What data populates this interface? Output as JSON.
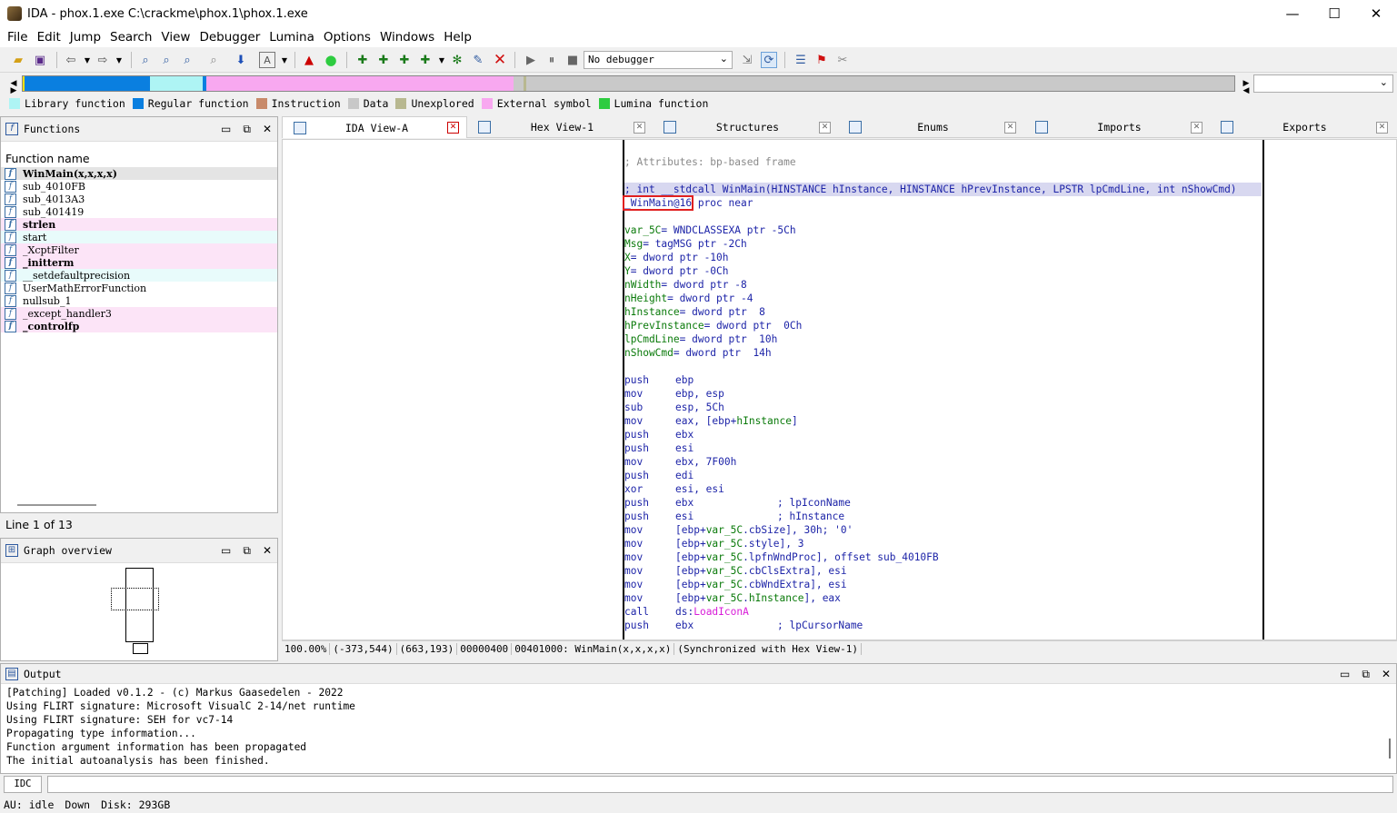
{
  "window": {
    "title": "IDA - phox.1.exe C:\\crackme\\phox.1\\phox.1.exe",
    "minimize": "—",
    "maximize": "☐",
    "close": "✕"
  },
  "menu": [
    "File",
    "Edit",
    "Jump",
    "Search",
    "View",
    "Debugger",
    "Lumina",
    "Options",
    "Windows",
    "Help"
  ],
  "toolbar": {
    "debugger_select": "No debugger"
  },
  "legend": [
    {
      "label": "Library function",
      "color": "#aef4f4"
    },
    {
      "label": "Regular function",
      "color": "#0a7fe0"
    },
    {
      "label": "Instruction",
      "color": "#c88a6a"
    },
    {
      "label": "Data",
      "color": "#c8c8c8"
    },
    {
      "label": "Unexplored",
      "color": "#b8b890"
    },
    {
      "label": "External symbol",
      "color": "#f8a8f0"
    },
    {
      "label": "Lumina function",
      "color": "#2ecc40"
    }
  ],
  "tabs": [
    {
      "label": "IDA View-A"
    },
    {
      "label": "Hex View-1"
    },
    {
      "label": "Structures"
    },
    {
      "label": "Enums"
    },
    {
      "label": "Imports"
    },
    {
      "label": "Exports"
    }
  ],
  "functions": {
    "title": "Functions",
    "column_header": "Function name",
    "items": [
      {
        "name": "WinMain(x,x,x,x)",
        "style": "sel bold"
      },
      {
        "name": "sub_4010FB",
        "style": ""
      },
      {
        "name": "sub_4013A3",
        "style": ""
      },
      {
        "name": "sub_401419",
        "style": ""
      },
      {
        "name": "strlen",
        "style": "ext bold"
      },
      {
        "name": "start",
        "style": "lib"
      },
      {
        "name": "_XcptFilter",
        "style": "ext"
      },
      {
        "name": "_initterm",
        "style": "ext bold"
      },
      {
        "name": "__setdefaultprecision",
        "style": "lib"
      },
      {
        "name": "UserMathErrorFunction",
        "style": ""
      },
      {
        "name": "nullsub_1",
        "style": ""
      },
      {
        "name": "_except_handler3",
        "style": "ext"
      },
      {
        "name": "_controlfp",
        "style": "ext bold"
      }
    ],
    "line_count": "Line 1 of 13"
  },
  "graph": {
    "title": "Graph overview"
  },
  "code": {
    "attributes": "; Attributes: bp-based frame",
    "signature": "; int __stdcall WinMain(HINSTANCE hInstance, HINSTANCE hPrevInstance, LPSTR lpCmdLine, int nShowCmd)",
    "proc_name": "_WinMain@16",
    "proc_rest": " proc near",
    "vars": [
      [
        "var_5C",
        "= WNDCLASSEXA ptr -5Ch"
      ],
      [
        "Msg",
        "= tagMSG ptr -2Ch"
      ],
      [
        "X",
        "= dword ptr -10h"
      ],
      [
        "Y",
        "= dword ptr -0Ch"
      ],
      [
        "nWidth",
        "= dword ptr -8"
      ],
      [
        "nHeight",
        "= dword ptr -4"
      ],
      [
        "hInstance",
        "= dword ptr  8"
      ],
      [
        "hPrevInstance",
        "= dword ptr  0Ch"
      ],
      [
        "lpCmdLine",
        "= dword ptr  10h"
      ],
      [
        "nShowCmd",
        "= dword ptr  14h"
      ]
    ],
    "instructions": [
      [
        "push",
        "ebp",
        ""
      ],
      [
        "mov",
        "ebp, esp",
        ""
      ],
      [
        "sub",
        "esp, 5Ch",
        ""
      ],
      [
        "mov",
        "eax, [ebp+hInstance]",
        ""
      ],
      [
        "push",
        "ebx",
        ""
      ],
      [
        "push",
        "esi",
        ""
      ],
      [
        "mov",
        "ebx, 7F00h",
        ""
      ],
      [
        "push",
        "edi",
        ""
      ],
      [
        "xor",
        "esi, esi",
        ""
      ],
      [
        "push",
        "ebx",
        "; lpIconName"
      ],
      [
        "push",
        "esi",
        "; hInstance"
      ],
      [
        "mov",
        "[ebp+var_5C.cbSize], 30h",
        "; '0'"
      ],
      [
        "mov",
        "[ebp+var_5C.style], 3",
        ""
      ],
      [
        "mov",
        "[ebp+var_5C.lpfnWndProc], offset sub_4010FB",
        ""
      ],
      [
        "mov",
        "[ebp+var_5C.cbClsExtra], esi",
        ""
      ],
      [
        "mov",
        "[ebp+var_5C.cbWndExtra], esi",
        ""
      ],
      [
        "mov",
        "[ebp+var_5C.hInstance], eax",
        ""
      ],
      [
        "call",
        "ds:LoadIconA",
        ""
      ],
      [
        "push",
        "ebx",
        "; lpCursorName"
      ]
    ]
  },
  "status_line": [
    "100.00%",
    "(-373,544)",
    "(663,193)",
    "00000400",
    "00401000: WinMain(x,x,x,x)",
    "(Synchronized with Hex View-1)"
  ],
  "output": {
    "title": "Output",
    "lines": [
      "[Patching] Loaded v0.1.2 - (c) Markus Gaasedelen - 2022",
      "Using FLIRT signature: Microsoft VisualC 2-14/net runtime",
      "Using FLIRT signature: SEH for vc7-14",
      "Propagating type information...",
      "Function argument information has been propagated",
      "The initial autoanalysis has been finished."
    ]
  },
  "idc": {
    "button": "IDC"
  },
  "bottom_status": {
    "au": "AU:  idle",
    "dir": "Down",
    "disk": "Disk: 293GB"
  }
}
